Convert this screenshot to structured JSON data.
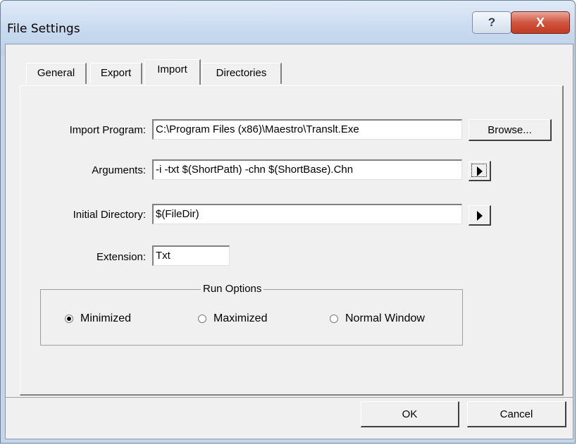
{
  "window": {
    "title": "File Settings",
    "help_label": "?",
    "close_label": "X"
  },
  "tabs": [
    {
      "label": "General",
      "active": false
    },
    {
      "label": "Export",
      "active": false
    },
    {
      "label": "Import",
      "active": true
    },
    {
      "label": "Directories",
      "active": false
    }
  ],
  "import_program": {
    "label": "Import Program:",
    "value": "C:\\Program Files (x86)\\Maestro\\Translt.Exe",
    "browse_label": "Browse..."
  },
  "arguments": {
    "label": "Arguments:",
    "value": "-i -txt $(ShortPath) -chn $(ShortBase).Chn"
  },
  "initial_directory": {
    "label": "Initial Directory:",
    "value": "$(FileDir)"
  },
  "extension": {
    "label": "Extension:",
    "value": "Txt"
  },
  "run_options": {
    "title": "Run Options",
    "options": [
      {
        "label": "Minimized",
        "checked": true
      },
      {
        "label": "Maximized",
        "checked": false
      },
      {
        "label": "Normal Window",
        "checked": false
      }
    ]
  },
  "buttons": {
    "ok_label": "OK",
    "cancel_label": "Cancel"
  },
  "icons": {
    "arguments_menu": "play-arrow-icon",
    "directory_menu": "play-arrow-icon"
  },
  "colors": {
    "titlebar": "#c4d6ec",
    "close_button": "#c13b24",
    "dialog_face": "#f0f0f0"
  }
}
